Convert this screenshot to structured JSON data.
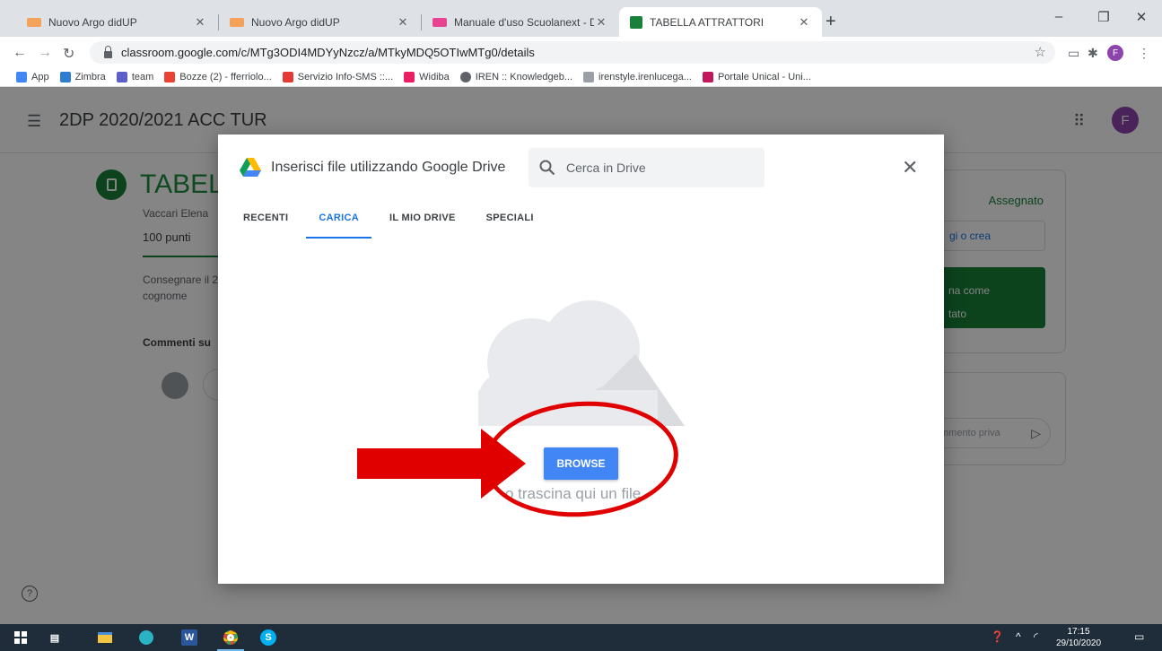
{
  "browser": {
    "tabs": [
      {
        "label": "Nuovo Argo didUP",
        "favicon_color": "#f4a259"
      },
      {
        "label": "Nuovo Argo didUP",
        "favicon_color": "#f4a259"
      },
      {
        "label": "Manuale d'uso Scuolanext - Doc",
        "favicon_color": "#e84393"
      },
      {
        "label": "TABELLA ATTRATTORI",
        "favicon_color": "#188038"
      }
    ],
    "new_tab": "+",
    "url": "classroom.google.com/c/MTg3ODI4MDYyNzcz/a/MTkyMDQ5OTIwMTg0/details",
    "profile_initial": "F",
    "bookmarks": [
      {
        "label": "App",
        "color": "#4285f4"
      },
      {
        "label": "Zimbra",
        "color": "#2e7dd1"
      },
      {
        "label": "team",
        "color": "#5b5fc7"
      },
      {
        "label": "Bozze (2) - fferriolo...",
        "color": "#ea4335"
      },
      {
        "label": "Servizio Info-SMS ::...",
        "color": "#e53935"
      },
      {
        "label": "Widiba",
        "color": "#e91e63"
      },
      {
        "label": "IREN :: Knowledgeb...",
        "color": "#5f6368"
      },
      {
        "label": "irenstyle.irenlucega...",
        "color": "#9aa0a6"
      },
      {
        "label": "Portale Unical - Uni...",
        "color": "#c2185b"
      }
    ]
  },
  "classroom": {
    "class_title": "2DP 2020/2021 ACC TUR",
    "user_initial": "F",
    "assignment_title": "TABEL",
    "author": "Vaccari Elena",
    "points": "100 punti",
    "instructions": "Consegnare il 2DP cognome",
    "comments_label": "Commenti su",
    "status": "Assegnato",
    "add_work": "gi o crea",
    "mark_done_line1": "na come",
    "mark_done_line2": "tato",
    "private_comment": "mmento priva",
    "help": "?"
  },
  "picker": {
    "title": "Inserisci file utilizzando Google Drive",
    "search_placeholder": "Cerca in Drive",
    "tabs": [
      "RECENTI",
      "CARICA",
      "IL MIO DRIVE",
      "SPECIALI"
    ],
    "active_tab": "CARICA",
    "browse_label": "BROWSE",
    "drag_text": "o trascina qui un file"
  },
  "taskbar": {
    "time": "17:15",
    "date": "29/10/2020"
  },
  "colors": {
    "accent_blue": "#1a73e8",
    "browse_blue": "#4285f4",
    "classroom_green": "#188038",
    "annotation_red": "#e00000"
  }
}
